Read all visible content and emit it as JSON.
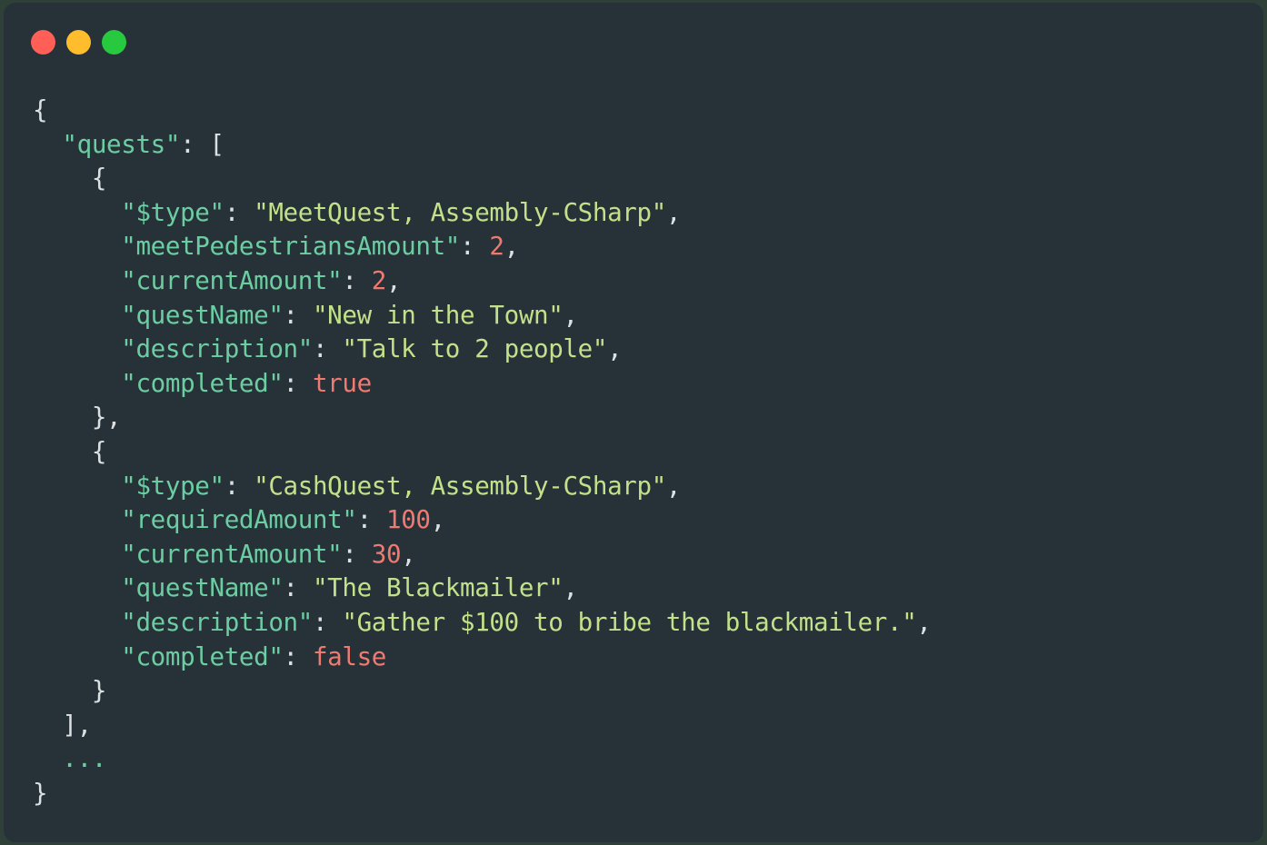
{
  "window": {
    "title": "JSON snippet",
    "traffic_lights": [
      {
        "name": "close",
        "color": "#ff5f56",
        "label": "Close"
      },
      {
        "name": "minimize",
        "color": "#ffbd2e",
        "label": "Minimize"
      },
      {
        "name": "maximize",
        "color": "#27c93f",
        "label": "Maximize"
      }
    ],
    "background": "#263238",
    "page_background": "#2f4038"
  },
  "theme": {
    "punctuation_color": "#dbe0e2",
    "key_color": "#6dcda2",
    "string_color": "#c3e08b",
    "number_color": "#ef7a71",
    "boolean_color": "#ef7a71",
    "ellipsis_color": "#6dcda2"
  },
  "code": {
    "language": "json",
    "lines": [
      {
        "indent": 0,
        "tokens": [
          {
            "t": "punc",
            "v": "{"
          }
        ]
      },
      {
        "indent": 2,
        "tokens": [
          {
            "t": "key",
            "v": "\"quests\""
          },
          {
            "t": "punc",
            "v": ": "
          },
          {
            "t": "punc",
            "v": "["
          }
        ]
      },
      {
        "indent": 4,
        "tokens": [
          {
            "t": "punc",
            "v": "{"
          }
        ]
      },
      {
        "indent": 6,
        "tokens": [
          {
            "t": "key",
            "v": "\"$type\""
          },
          {
            "t": "punc",
            "v": ": "
          },
          {
            "t": "str",
            "v": "\"MeetQuest, Assembly-CSharp\""
          },
          {
            "t": "punc",
            "v": ","
          }
        ]
      },
      {
        "indent": 6,
        "tokens": [
          {
            "t": "key",
            "v": "\"meetPedestriansAmount\""
          },
          {
            "t": "punc",
            "v": ": "
          },
          {
            "t": "num",
            "v": "2"
          },
          {
            "t": "punc",
            "v": ","
          }
        ]
      },
      {
        "indent": 6,
        "tokens": [
          {
            "t": "key",
            "v": "\"currentAmount\""
          },
          {
            "t": "punc",
            "v": ": "
          },
          {
            "t": "num",
            "v": "2"
          },
          {
            "t": "punc",
            "v": ","
          }
        ]
      },
      {
        "indent": 6,
        "tokens": [
          {
            "t": "key",
            "v": "\"questName\""
          },
          {
            "t": "punc",
            "v": ": "
          },
          {
            "t": "str",
            "v": "\"New in the Town\""
          },
          {
            "t": "punc",
            "v": ","
          }
        ]
      },
      {
        "indent": 6,
        "tokens": [
          {
            "t": "key",
            "v": "\"description\""
          },
          {
            "t": "punc",
            "v": ": "
          },
          {
            "t": "str",
            "v": "\"Talk to 2 people\""
          },
          {
            "t": "punc",
            "v": ","
          }
        ]
      },
      {
        "indent": 6,
        "tokens": [
          {
            "t": "key",
            "v": "\"completed\""
          },
          {
            "t": "punc",
            "v": ": "
          },
          {
            "t": "bool",
            "v": "true"
          }
        ]
      },
      {
        "indent": 4,
        "tokens": [
          {
            "t": "punc",
            "v": "},"
          }
        ]
      },
      {
        "indent": 4,
        "tokens": [
          {
            "t": "punc",
            "v": "{"
          }
        ]
      },
      {
        "indent": 6,
        "tokens": [
          {
            "t": "key",
            "v": "\"$type\""
          },
          {
            "t": "punc",
            "v": ": "
          },
          {
            "t": "str",
            "v": "\"CashQuest, Assembly-CSharp\""
          },
          {
            "t": "punc",
            "v": ","
          }
        ]
      },
      {
        "indent": 6,
        "tokens": [
          {
            "t": "key",
            "v": "\"requiredAmount\""
          },
          {
            "t": "punc",
            "v": ": "
          },
          {
            "t": "num",
            "v": "100"
          },
          {
            "t": "punc",
            "v": ","
          }
        ]
      },
      {
        "indent": 6,
        "tokens": [
          {
            "t": "key",
            "v": "\"currentAmount\""
          },
          {
            "t": "punc",
            "v": ": "
          },
          {
            "t": "num",
            "v": "30"
          },
          {
            "t": "punc",
            "v": ","
          }
        ]
      },
      {
        "indent": 6,
        "tokens": [
          {
            "t": "key",
            "v": "\"questName\""
          },
          {
            "t": "punc",
            "v": ": "
          },
          {
            "t": "str",
            "v": "\"The Blackmailer\""
          },
          {
            "t": "punc",
            "v": ","
          }
        ]
      },
      {
        "indent": 6,
        "tokens": [
          {
            "t": "key",
            "v": "\"description\""
          },
          {
            "t": "punc",
            "v": ": "
          },
          {
            "t": "str",
            "v": "\"Gather $100 to bribe the blackmailer.\""
          },
          {
            "t": "punc",
            "v": ","
          }
        ]
      },
      {
        "indent": 6,
        "tokens": [
          {
            "t": "key",
            "v": "\"completed\""
          },
          {
            "t": "punc",
            "v": ": "
          },
          {
            "t": "bool",
            "v": "false"
          }
        ]
      },
      {
        "indent": 4,
        "tokens": [
          {
            "t": "punc",
            "v": "}"
          }
        ]
      },
      {
        "indent": 2,
        "tokens": [
          {
            "t": "punc",
            "v": "],"
          }
        ]
      },
      {
        "indent": 2,
        "tokens": [
          {
            "t": "ellip",
            "v": "..."
          }
        ]
      },
      {
        "indent": 0,
        "tokens": [
          {
            "t": "punc",
            "v": "}"
          }
        ]
      }
    ]
  }
}
